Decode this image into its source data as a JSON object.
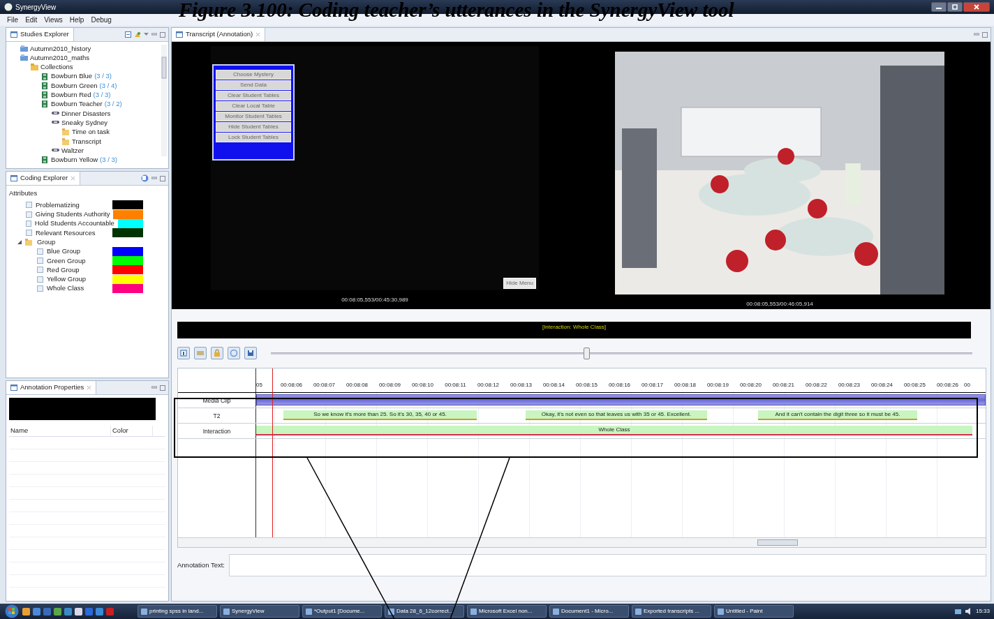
{
  "caption": "Figure 3.100: Coding teacher’s utterances in the SynergyView tool",
  "window": {
    "title": "SynergyView"
  },
  "menu": [
    "File",
    "Edit",
    "Views",
    "Help",
    "Debug"
  ],
  "studies_explorer": {
    "title": "Studies Explorer",
    "tree": [
      {
        "label": "Autumn2010_history",
        "kind": "study"
      },
      {
        "label": "Autumn2010_maths",
        "kind": "study",
        "children": [
          {
            "label": "Collections",
            "kind": "collection",
            "children": [
              {
                "label": "Bowburn Blue",
                "count": "(3 / 3)",
                "kind": "clip"
              },
              {
                "label": "Bowburn Green",
                "count": "(3 / 4)",
                "kind": "clip"
              },
              {
                "label": "Bowburn Red",
                "count": "(3 / 3)",
                "kind": "clip"
              },
              {
                "label": "Bowburn Teacher",
                "count": "(3 / 2)",
                "kind": "clip",
                "children": [
                  {
                    "label": "Dinner Disasters",
                    "kind": "session"
                  },
                  {
                    "label": "Sneaky Sydney",
                    "kind": "session",
                    "children": [
                      {
                        "label": "Time on task",
                        "kind": "folder"
                      },
                      {
                        "label": "Transcript",
                        "kind": "folder"
                      }
                    ]
                  },
                  {
                    "label": "Waltzer",
                    "kind": "session"
                  }
                ]
              },
              {
                "label": "Bowburn Yellow",
                "count": "(3 / 3)",
                "kind": "clip"
              }
            ]
          }
        ]
      }
    ]
  },
  "coding_explorer": {
    "title": "Coding Explorer",
    "heading": "Attributes",
    "items": [
      {
        "label": "Problematizing",
        "kind": "code",
        "checked": false,
        "color": "#000000"
      },
      {
        "label": "Giving Students Authority",
        "kind": "code",
        "checked": false,
        "color": "#ff7f00"
      },
      {
        "label": "Hold Students Accountable",
        "kind": "code",
        "checked": false,
        "color": "#00ffff"
      },
      {
        "label": "Relevant Resources",
        "kind": "code",
        "checked": false,
        "color": "#003300"
      },
      {
        "label": "Group",
        "kind": "group",
        "expanded": true,
        "children": [
          {
            "label": "Blue Group",
            "kind": "code",
            "checked": false,
            "color": "#0000ff"
          },
          {
            "label": "Green Group",
            "kind": "code",
            "checked": false,
            "color": "#00ff00"
          },
          {
            "label": "Red Group",
            "kind": "code",
            "checked": false,
            "color": "#ff0000"
          },
          {
            "label": "Yellow Group",
            "kind": "code",
            "checked": false,
            "color": "#ffff00"
          },
          {
            "label": "Whole Class",
            "kind": "code",
            "checked": false,
            "color": "#ff0080"
          }
        ]
      }
    ]
  },
  "annotation_properties": {
    "title": "Annotation Properties",
    "columns": [
      "Name",
      "Color"
    ]
  },
  "editor": {
    "tab": "Transcript (Annotation)",
    "videos": [
      {
        "kind": "screen",
        "menu": [
          "Choose Mystery",
          "Send Data",
          "Clear Student Tables",
          "Clear Local Table",
          "Monitor Student Tables",
          "Hide Student Tables",
          "Lock Student Tables"
        ],
        "hide_menu": "Hide Menu",
        "time": "00:08:05,553/00:45:30,989"
      },
      {
        "kind": "picture",
        "time": "00:08:05,553/00:46:05,914"
      }
    ],
    "status": "[Interaction: Whole Class]",
    "scrubber": {
      "level": 0.45
    },
    "timeline": {
      "ticks": [
        "05",
        "00:08:06",
        "00:08:07",
        "00:08:08",
        "00:08:09",
        "00:08:10",
        "00:08:11",
        "00:08:12",
        "00:08:13",
        "00:08:14",
        "00:08:15",
        "00:08:16",
        "00:08:17",
        "00:08:18",
        "00:08:19",
        "00:08:20",
        "00:08:21",
        "00:08:22",
        "00:08:23",
        "00:08:24",
        "00:08:25",
        "00:08:26",
        "00"
      ],
      "rows": [
        {
          "label": "Media Clip",
          "kind": "clip"
        },
        {
          "label": "T2",
          "kind": "utterances",
          "segments": [
            "So we know it's more than 25. So it's 30, 35, 40 or 45.",
            "Okay, it's not even so that leaves us with 35 or 45. Excellent.",
            "And it can't contain the digit three so it must be 45."
          ]
        },
        {
          "label": "Interaction",
          "kind": "code",
          "segments": [
            "Whole Class"
          ]
        }
      ]
    },
    "annotation_text": {
      "label": "Annotation Text:"
    }
  },
  "taskbar": {
    "tasks": [
      "printing spss in land...",
      "SynergyView",
      "*Output1 [Docume...",
      "Data 28_6_12correct...",
      "Microsoft Excel non...",
      "Document1 - Micro...",
      "Exported transcripts ...",
      "Untitled - Paint"
    ],
    "clock": "15:33"
  }
}
